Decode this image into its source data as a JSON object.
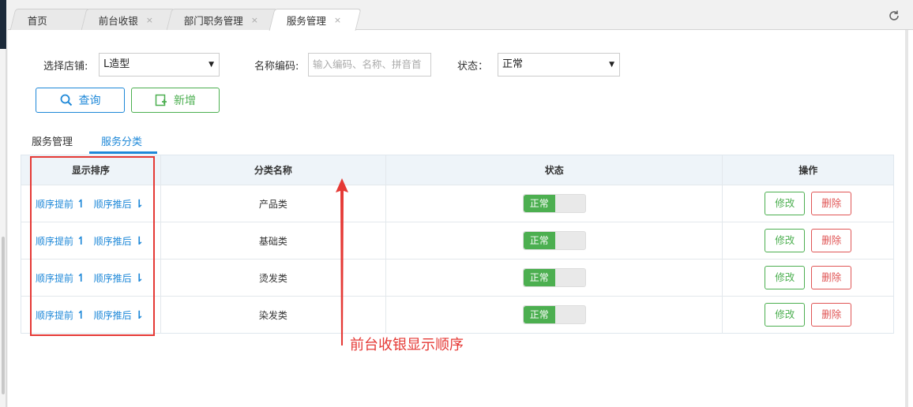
{
  "tabs": [
    {
      "label": "首页",
      "closable": false,
      "active": false
    },
    {
      "label": "前台收银",
      "closable": true,
      "active": false
    },
    {
      "label": "部门职务管理",
      "closable": true,
      "active": false
    },
    {
      "label": "服务管理",
      "closable": true,
      "active": true
    }
  ],
  "close_glyph": "×",
  "refresh_icon": "refresh-icon",
  "filters": {
    "store_label": "选择店铺:",
    "store_value": "L造型",
    "name_code_label": "名称编码:",
    "name_code_placeholder": "输入编码、名称、拼音首",
    "status_label": "状态：",
    "status_value": "正常"
  },
  "buttons": {
    "query": "查询",
    "add": "新增"
  },
  "subtabs": [
    {
      "label": "服务管理",
      "active": false
    },
    {
      "label": "服务分类",
      "active": true
    }
  ],
  "table": {
    "headers": [
      "显示排序",
      "分类名称",
      "状态",
      "操作"
    ],
    "rows": [
      {
        "move_up": "顺序提前",
        "move_down": "顺序推后",
        "name": "产品类",
        "status": "正常",
        "edit": "修改",
        "delete": "删除"
      },
      {
        "move_up": "顺序提前",
        "move_down": "顺序推后",
        "name": "基础类",
        "status": "正常",
        "edit": "修改",
        "delete": "删除"
      },
      {
        "move_up": "顺序提前",
        "move_down": "顺序推后",
        "name": "烫发类",
        "status": "正常",
        "edit": "修改",
        "delete": "删除"
      },
      {
        "move_up": "顺序提前",
        "move_down": "顺序推后",
        "name": "染发类",
        "status": "正常",
        "edit": "修改",
        "delete": "删除"
      }
    ]
  },
  "annotation": "前台收银显示顺序",
  "colors": {
    "primary": "#1e88d8",
    "success": "#4caf50",
    "danger": "#e05555",
    "annotation": "#e53935"
  }
}
